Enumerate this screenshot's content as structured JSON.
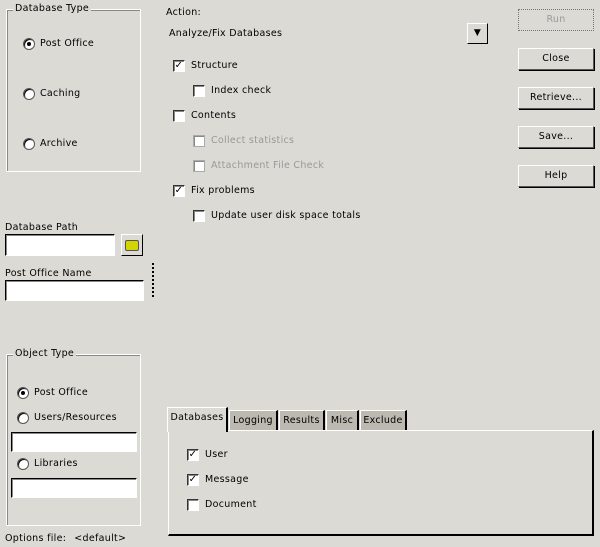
{
  "database_type": {
    "title": "Database Type",
    "options": [
      {
        "label": "Post Office",
        "selected": true
      },
      {
        "label": "Caching",
        "selected": false
      },
      {
        "label": "Archive",
        "selected": false
      }
    ]
  },
  "action": {
    "label": "Action:",
    "value": "Analyze/Fix Databases",
    "options": [
      {
        "label": "Structure",
        "checked": true,
        "enabled": true
      },
      {
        "label": "Index check",
        "checked": false,
        "enabled": true
      },
      {
        "label": "Contents",
        "checked": false,
        "enabled": true
      },
      {
        "label": "Collect statistics",
        "checked": false,
        "enabled": false
      },
      {
        "label": "Attachment File Check",
        "checked": false,
        "enabled": false
      },
      {
        "label": "Fix problems",
        "checked": true,
        "enabled": true
      },
      {
        "label": "Update user disk space totals",
        "checked": false,
        "enabled": true
      }
    ]
  },
  "buttons": {
    "run": "Run",
    "close": "Close",
    "retrieve": "Retrieve...",
    "save": "Save...",
    "help": "Help"
  },
  "database_path": {
    "label": "Database Path",
    "value": ""
  },
  "post_office_name": {
    "label": "Post Office Name",
    "value": ""
  },
  "object_type": {
    "title": "Object Type",
    "options": [
      {
        "label": "Post Office",
        "selected": true
      },
      {
        "label": "Users/Resources",
        "selected": false
      },
      {
        "label": "Libraries",
        "selected": false
      }
    ],
    "users_value": "",
    "libraries_value": ""
  },
  "options_file": {
    "label": "Options file:",
    "value": "<default>"
  },
  "tabs": [
    "Databases",
    "Logging",
    "Results",
    "Misc",
    "Exclude"
  ],
  "databases_tab": [
    {
      "label": "User",
      "checked": true
    },
    {
      "label": "Message",
      "checked": true
    },
    {
      "label": "Document",
      "checked": false
    }
  ]
}
